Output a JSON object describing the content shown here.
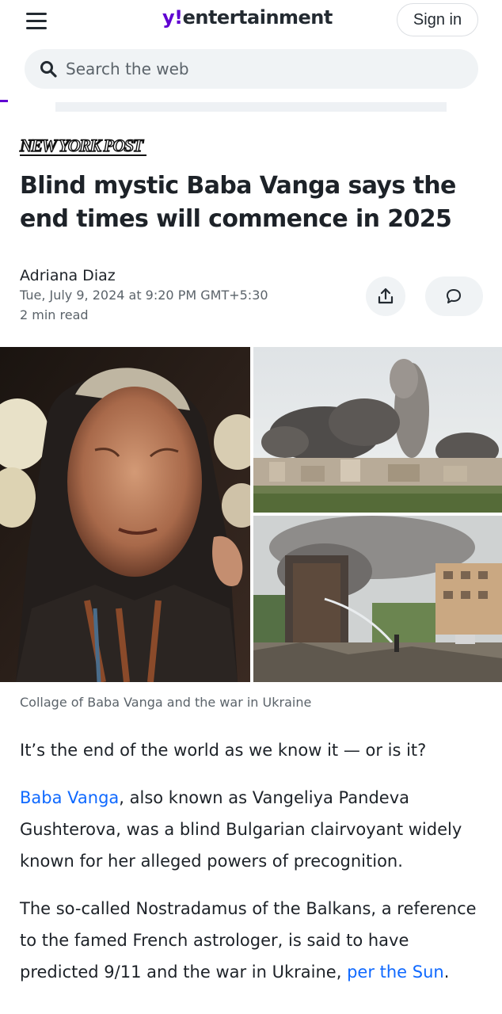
{
  "header": {
    "logo_mark": "y!",
    "logo_text": "entertainment",
    "signin_label": "Sign in",
    "search_placeholder": "Search the web",
    "accent_color": "#6001d2"
  },
  "article": {
    "publisher": "New York Post",
    "title": "Blind mystic Baba Vanga says the end times will commence in 2025",
    "author": "Adriana Diaz",
    "date": "Tue, July 9, 2024 at 9:20 PM GMT+5:30",
    "read_time": "2 min read",
    "share_icon": "share-icon",
    "comment_icon": "comment-icon",
    "image_caption": "Collage of Baba Vanga and the war in Ukraine",
    "lead": "It’s the end of the world as we know it — or is it?",
    "p1_link": "Baba Vanga",
    "p1_text": ", also known as Vangeliya Pandeva Gushterova, was a blind Bulgarian clairvoyant widely known for her alleged powers of precognition.",
    "p2_text": "The so-called Nostradamus of the Balkans, a reference to the famed French astrologer, is said to have predicted 9/11 and the war in Ukraine, ",
    "p2_link": "per the Sun",
    "p2_end": ".",
    "link_color": "#0f69ff"
  }
}
